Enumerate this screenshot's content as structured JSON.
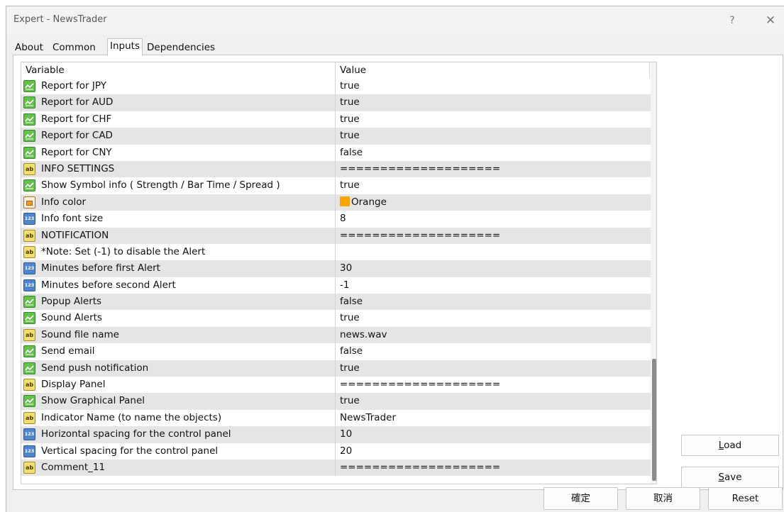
{
  "window": {
    "title": "Expert - NewsTrader",
    "help_label": "?",
    "close_label": "✕"
  },
  "tabs": [
    {
      "label": "About",
      "active": false
    },
    {
      "label": "Common",
      "active": false
    },
    {
      "label": "Inputs",
      "active": true
    },
    {
      "label": "Dependencies",
      "active": false
    }
  ],
  "grid": {
    "columns": [
      "Variable",
      "Value"
    ],
    "rows": [
      {
        "type": "bool",
        "icon": "bool-icon",
        "variable": "Report for JPY",
        "value": "true"
      },
      {
        "type": "bool",
        "icon": "bool-icon",
        "variable": "Report for AUD",
        "value": "true"
      },
      {
        "type": "bool",
        "icon": "bool-icon",
        "variable": "Report for CHF",
        "value": "true"
      },
      {
        "type": "bool",
        "icon": "bool-icon",
        "variable": "Report for CAD",
        "value": "true"
      },
      {
        "type": "bool",
        "icon": "bool-icon",
        "variable": "Report for CNY",
        "value": "false"
      },
      {
        "type": "string",
        "icon": "string-icon",
        "variable": "INFO SETTINGS",
        "value": "===================="
      },
      {
        "type": "bool",
        "icon": "bool-icon",
        "variable": "Show Symbol info ( Strength / Bar Time / Spread )",
        "value": "true"
      },
      {
        "type": "color",
        "icon": "color-icon",
        "variable": "Info color",
        "value": "Orange",
        "swatch": "#ffa500"
      },
      {
        "type": "number",
        "icon": "number-icon",
        "variable": "Info font size",
        "value": "8"
      },
      {
        "type": "string",
        "icon": "string-icon",
        "variable": "NOTIFICATION",
        "value": "===================="
      },
      {
        "type": "string",
        "icon": "string-icon",
        "variable": "*Note: Set (-1) to disable the Alert",
        "value": ""
      },
      {
        "type": "number",
        "icon": "number-icon",
        "variable": "Minutes before first Alert",
        "value": "30"
      },
      {
        "type": "number",
        "icon": "number-icon",
        "variable": "Minutes before second Alert",
        "value": "-1"
      },
      {
        "type": "bool",
        "icon": "bool-icon",
        "variable": "Popup Alerts",
        "value": "false"
      },
      {
        "type": "bool",
        "icon": "bool-icon",
        "variable": "Sound Alerts",
        "value": "true"
      },
      {
        "type": "string",
        "icon": "string-icon",
        "variable": "Sound file name",
        "value": "news.wav"
      },
      {
        "type": "bool",
        "icon": "bool-icon",
        "variable": "Send email",
        "value": "false"
      },
      {
        "type": "bool",
        "icon": "bool-icon",
        "variable": "Send push notification",
        "value": "true"
      },
      {
        "type": "string",
        "icon": "string-icon",
        "variable": "Display Panel",
        "value": "===================="
      },
      {
        "type": "bool",
        "icon": "bool-icon",
        "variable": "Show Graphical Panel",
        "value": "true"
      },
      {
        "type": "string",
        "icon": "string-icon",
        "variable": "Indicator Name (to name the objects)",
        "value": "NewsTrader"
      },
      {
        "type": "number",
        "icon": "number-icon",
        "variable": "Horizontal spacing for the control panel",
        "value": "10"
      },
      {
        "type": "number",
        "icon": "number-icon",
        "variable": "Vertical spacing for the control panel",
        "value": "20"
      },
      {
        "type": "string",
        "icon": "string-icon",
        "variable": "Comment_11",
        "value": "===================="
      }
    ]
  },
  "side_buttons": {
    "load_first": "L",
    "load_rest": "oad",
    "save_first": "S",
    "save_rest": "ave"
  },
  "bottom_buttons": {
    "ok": "確定",
    "cancel": "取消",
    "reset": "Reset"
  },
  "icon_text": {
    "string": "ab",
    "number": "123"
  },
  "colors": {
    "alt_row": "#e5e5e5",
    "orange": "#ffa500"
  }
}
